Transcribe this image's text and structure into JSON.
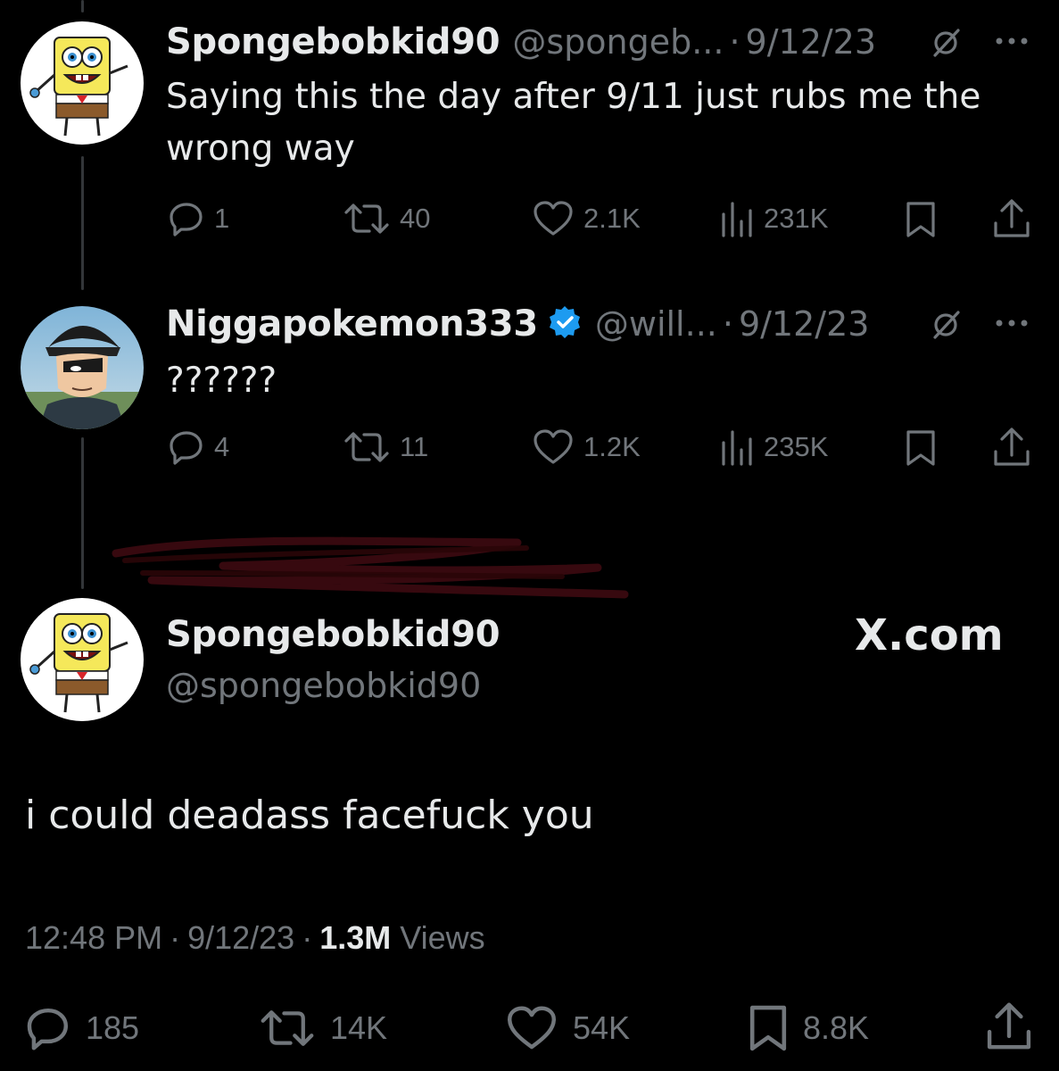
{
  "tweets": [
    {
      "name": "Spongebobkid90",
      "handle": "@spongeb...",
      "date": "9/12/23",
      "text": "Saying this the day after 9/11 just rubs me the wrong way",
      "replies": "1",
      "reposts": "40",
      "likes": "2.1K",
      "views": "231K"
    },
    {
      "name": "Niggapokemon333",
      "handle": "@will...",
      "date": "9/12/23",
      "text": "??????",
      "replies": "4",
      "reposts": "11",
      "likes": "1.2K",
      "views": "235K"
    }
  ],
  "main_tweet": {
    "name": "Spongebobkid90",
    "handle": "@spongebobkid90",
    "watermark": "X.com",
    "text": "i could deadass facefuck you",
    "time": "12:48 PM",
    "date": "9/12/23",
    "views_count": "1.3M",
    "views_label": "Views",
    "replies": "185",
    "reposts": "14K",
    "likes": "54K",
    "bookmarks": "8.8K"
  },
  "separators": {
    "dot": "·"
  },
  "icons": [
    "reply-icon",
    "repost-icon",
    "like-icon",
    "views-icon",
    "bookmark-icon",
    "share-icon",
    "more-icon",
    "grok-icon",
    "verified-badge-icon"
  ],
  "colors": {
    "background": "#000000",
    "text": "#e7e9ea",
    "muted": "#71767b",
    "verified": "#1d9bf0",
    "thread_line": "#333639"
  }
}
